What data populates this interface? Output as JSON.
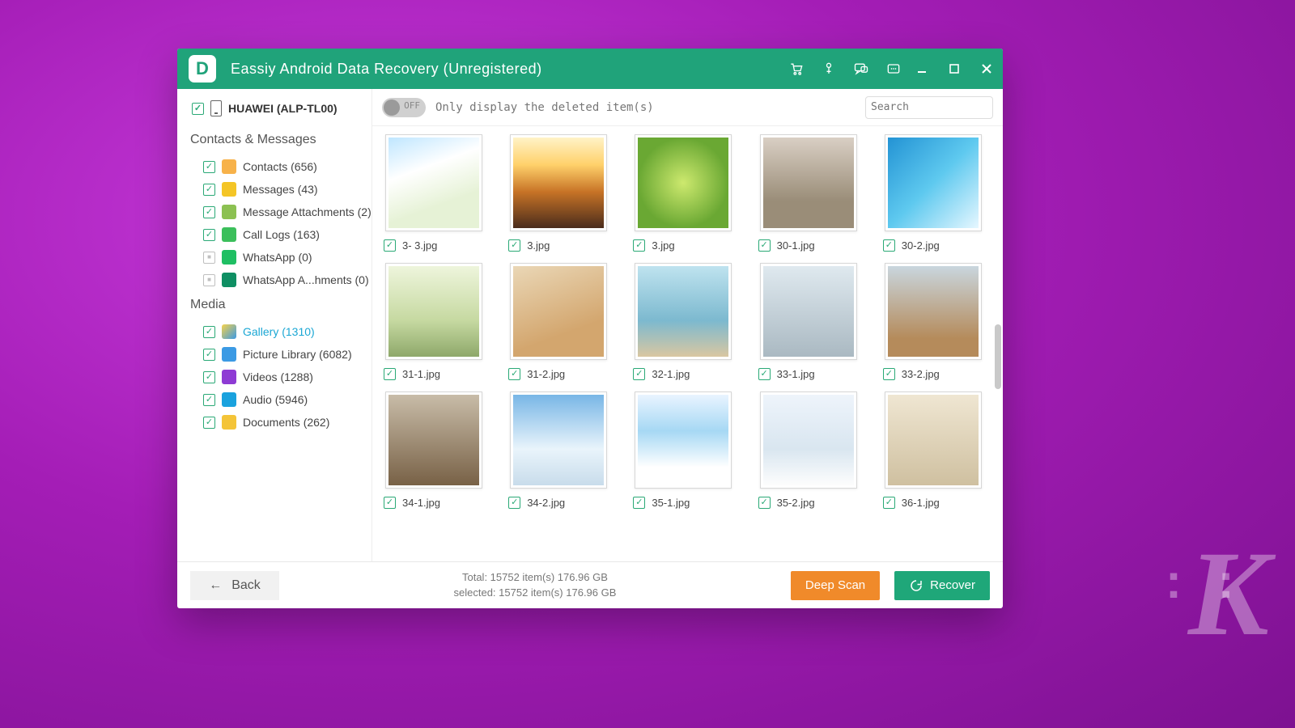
{
  "titlebar": {
    "title": "Eassiy Android Data Recovery (Unregistered)"
  },
  "device": {
    "name": "HUAWEI (ALP-TL00)"
  },
  "sidebar": {
    "group1": "Contacts & Messages",
    "group2": "Media",
    "items1": [
      {
        "label": "Contacts (656)"
      },
      {
        "label": "Messages (43)"
      },
      {
        "label": "Message Attachments (2)"
      },
      {
        "label": "Call Logs (163)"
      },
      {
        "label": "WhatsApp (0)"
      },
      {
        "label": "WhatsApp A...hments (0)"
      }
    ],
    "items2": [
      {
        "label": "Gallery (1310)"
      },
      {
        "label": "Picture Library (6082)"
      },
      {
        "label": "Videos (1288)"
      },
      {
        "label": "Audio (5946)"
      },
      {
        "label": "Documents (262)"
      }
    ]
  },
  "toolbar": {
    "toggle_state": "OFF",
    "deleted_hint": "Only display the deleted item(s)",
    "search_placeholder": "Search"
  },
  "thumbs": [
    {
      "name": "3- 3.jpg"
    },
    {
      "name": "3.jpg"
    },
    {
      "name": "3.jpg"
    },
    {
      "name": "30-1.jpg"
    },
    {
      "name": "30-2.jpg"
    },
    {
      "name": "31-1.jpg"
    },
    {
      "name": "31-2.jpg"
    },
    {
      "name": "32-1.jpg"
    },
    {
      "name": "33-1.jpg"
    },
    {
      "name": "33-2.jpg"
    },
    {
      "name": "34-1.jpg"
    },
    {
      "name": "34-2.jpg"
    },
    {
      "name": "35-1.jpg"
    },
    {
      "name": "35-2.jpg"
    },
    {
      "name": "36-1.jpg"
    }
  ],
  "footer": {
    "back": "Back",
    "total_line": "Total: 15752 item(s) 176.96 GB",
    "selected_line": "selected: 15752 item(s) 176.96 GB",
    "deep_scan": "Deep Scan",
    "recover": "Recover"
  }
}
